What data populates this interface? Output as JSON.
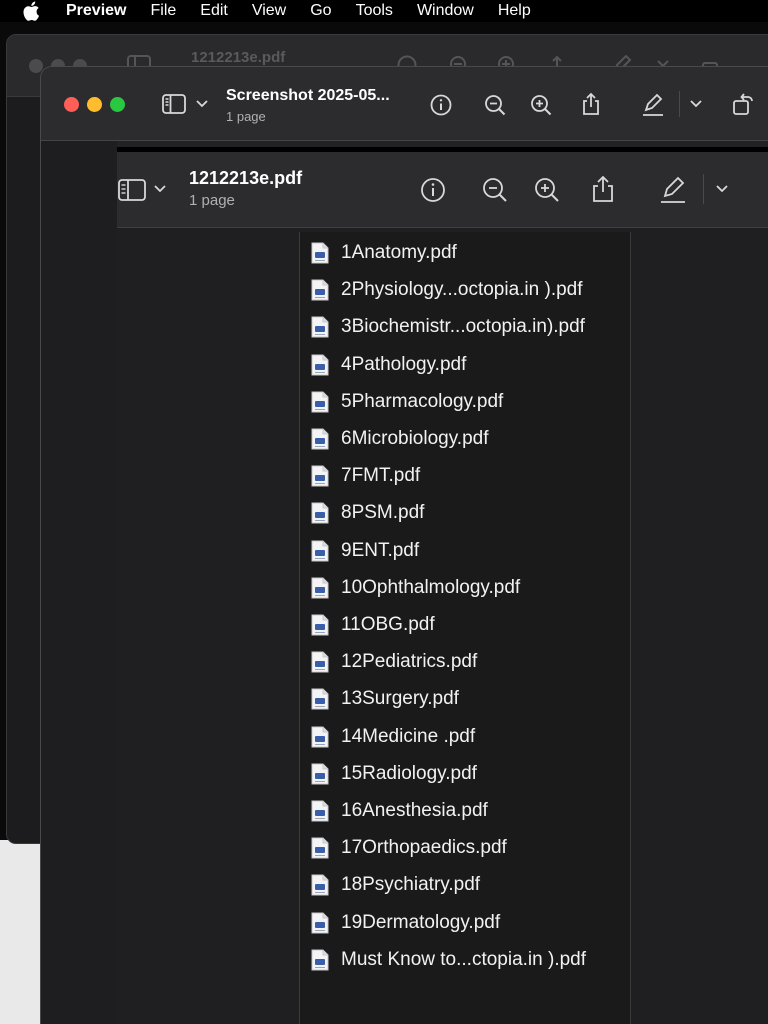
{
  "menubar": {
    "apple_icon": "apple-icon",
    "items": [
      "Preview",
      "File",
      "Edit",
      "View",
      "Go",
      "Tools",
      "Window",
      "Help"
    ]
  },
  "back_window": {
    "title": "1212213e.pdf"
  },
  "front_window": {
    "title": "Screenshot 2025-05...",
    "subtitle": "1 page"
  },
  "embedded_window": {
    "title": "1212213e.pdf",
    "subtitle": "1 page"
  },
  "toolbar_icons": [
    "sidebar-icon",
    "chevron-down-icon",
    "info-icon",
    "zoom-out-icon",
    "zoom-in-icon",
    "share-icon",
    "markup-pen-icon",
    "chevron-down-icon",
    "rotate-icon"
  ],
  "files": [
    "1Anatomy.pdf",
    "2Physiology...octopia.in ).pdf",
    "3Biochemistr...octopia.in).pdf",
    "4Pathology.pdf",
    "5Pharmacology.pdf",
    "6Microbiology.pdf",
    "7FMT.pdf",
    "8PSM.pdf",
    "9ENT.pdf",
    "10Ophthalmology.pdf",
    "11OBG.pdf",
    "12Pediatrics.pdf",
    "13Surgery.pdf",
    "14Medicine .pdf",
    "15Radiology.pdf",
    "16Anesthesia.pdf",
    "17Orthopaedics.pdf",
    "18Psychiatry.pdf",
    "19Dermatology.pdf",
    "Must Know to...ctopia.in ).pdf"
  ],
  "colors": {
    "traffic_red": "#ff5f57",
    "traffic_yellow": "#febc2e",
    "traffic_green": "#28c840",
    "window_bg": "#222224",
    "toolbar_bg": "#2c2c2e"
  }
}
